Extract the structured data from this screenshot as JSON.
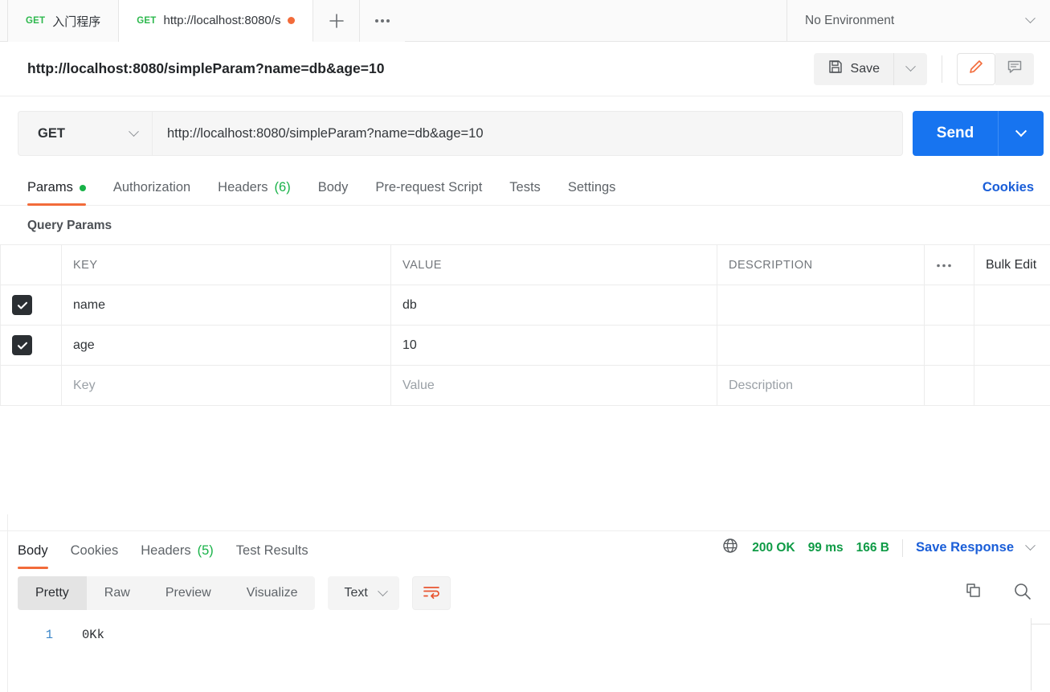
{
  "window": {
    "tabs": [
      {
        "method": "GET",
        "title": "入门程序",
        "unsaved": false,
        "active": false
      },
      {
        "method": "GET",
        "title": "http://localhost:8080/s",
        "unsaved": true,
        "active": true
      }
    ],
    "new_tab_label": "+",
    "tab_more_label": "●●●",
    "environment": {
      "label": "No Environment"
    }
  },
  "namebar": {
    "request_name": "http://localhost:8080/simpleParam?name=db&age=10",
    "save_label": "Save"
  },
  "urlbar": {
    "method": "GET",
    "url": "http://localhost:8080/simpleParam?name=db&age=10",
    "send_label": "Send"
  },
  "request_tabs": {
    "items": [
      {
        "label": "Params",
        "active": true,
        "dot": true
      },
      {
        "label": "Authorization",
        "active": false
      },
      {
        "label": "Headers",
        "count": "(6)",
        "active": false
      },
      {
        "label": "Body",
        "active": false
      },
      {
        "label": "Pre-request Script",
        "active": false
      },
      {
        "label": "Tests",
        "active": false
      },
      {
        "label": "Settings",
        "active": false
      }
    ],
    "cookies_label": "Cookies"
  },
  "query_params": {
    "section_title": "Query Params",
    "headers": {
      "key": "KEY",
      "value": "VALUE",
      "description": "DESCRIPTION",
      "more": "●●●",
      "bulk_edit": "Bulk Edit"
    },
    "rows": [
      {
        "checked": true,
        "key": "name",
        "value": "db",
        "description": ""
      },
      {
        "checked": true,
        "key": "age",
        "value": "10",
        "description": ""
      }
    ],
    "placeholder_row": {
      "key": "Key",
      "value": "Value",
      "description": "Description"
    }
  },
  "response": {
    "tabs": [
      {
        "label": "Body",
        "active": true
      },
      {
        "label": "Cookies",
        "active": false
      },
      {
        "label": "Headers",
        "count": "(5)",
        "active": false
      },
      {
        "label": "Test Results",
        "active": false
      }
    ],
    "status": "200 OK",
    "time": "99 ms",
    "size": "166 B",
    "save_response_label": "Save Response",
    "view_modes": [
      {
        "label": "Pretty",
        "active": true
      },
      {
        "label": "Raw",
        "active": false
      },
      {
        "label": "Preview",
        "active": false
      },
      {
        "label": "Visualize",
        "active": false
      }
    ],
    "format": "Text",
    "body": {
      "lines": [
        {
          "number": "1",
          "text": "0Kk"
        }
      ]
    }
  },
  "colors": {
    "accent_orange": "#f26b3a",
    "send_blue": "#1774f0",
    "link_blue": "#1a5ed8",
    "success_green": "#18b248",
    "status_green": "#0f9b46",
    "method_green": "#2db84d"
  }
}
